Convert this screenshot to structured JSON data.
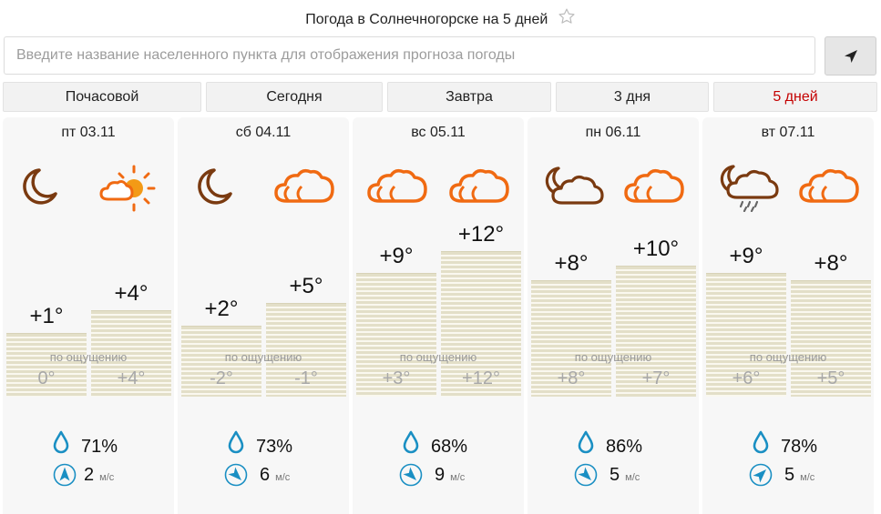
{
  "title": "Погода в Солнечногорске на 5 дней",
  "search": {
    "placeholder": "Введите название населенного пункта для отображения прогноза погоды"
  },
  "tabs": [
    {
      "label": "Почасовой"
    },
    {
      "label": "Сегодня"
    },
    {
      "label": "Завтра"
    },
    {
      "label": "3 дня"
    },
    {
      "label": "5 дней"
    }
  ],
  "feels_label": "по ощущению",
  "wind_unit": "м/с",
  "colors": {
    "accent_red": "#c40000",
    "icon_brown": "#7a3a10",
    "icon_orange": "#f06a12",
    "sun_core": "#f39a16",
    "drop_blue": "#1a8fc3"
  },
  "days": [
    {
      "date": "пт 03.11",
      "night_icon": "moon-icon",
      "day_icon": "partly-sunny-icon",
      "night_temp": "+1°",
      "day_temp": "+4°",
      "night_temp_value": 1,
      "day_temp_value": 4,
      "feels_night": "0°",
      "feels_day": "+4°",
      "humidity": "71%",
      "wind_speed": "2",
      "wind_direction_icon": "wind-arrow-north-icon"
    },
    {
      "date": "сб 04.11",
      "night_icon": "moon-icon",
      "day_icon": "cloudy-icon",
      "night_temp": "+2°",
      "day_temp": "+5°",
      "night_temp_value": 2,
      "day_temp_value": 5,
      "feels_night": "-2°",
      "feels_day": "-1°",
      "humidity": "73%",
      "wind_speed": "6",
      "wind_direction_icon": "wind-arrow-southeast-icon"
    },
    {
      "date": "вс 05.11",
      "night_icon": "cloudy-icon",
      "day_icon": "cloudy-icon",
      "night_temp": "+9°",
      "day_temp": "+12°",
      "night_temp_value": 9,
      "day_temp_value": 12,
      "feels_night": "+3°",
      "feels_day": "+12°",
      "humidity": "68%",
      "wind_speed": "9",
      "wind_direction_icon": "wind-arrow-southeast-icon"
    },
    {
      "date": "пн 06.11",
      "night_icon": "moon-cloud-icon",
      "day_icon": "cloudy-icon",
      "night_temp": "+8°",
      "day_temp": "+10°",
      "night_temp_value": 8,
      "day_temp_value": 10,
      "feels_night": "+8°",
      "feels_day": "+7°",
      "humidity": "86%",
      "wind_speed": "5",
      "wind_direction_icon": "wind-arrow-southeast-icon"
    },
    {
      "date": "вт 07.11",
      "night_icon": "moon-cloud-rain-icon",
      "day_icon": "cloudy-icon",
      "night_temp": "+9°",
      "day_temp": "+8°",
      "night_temp_value": 9,
      "day_temp_value": 8,
      "feels_night": "+6°",
      "feels_day": "+5°",
      "humidity": "78%",
      "wind_speed": "5",
      "wind_direction_icon": "wind-arrow-northeast-icon"
    }
  ]
}
